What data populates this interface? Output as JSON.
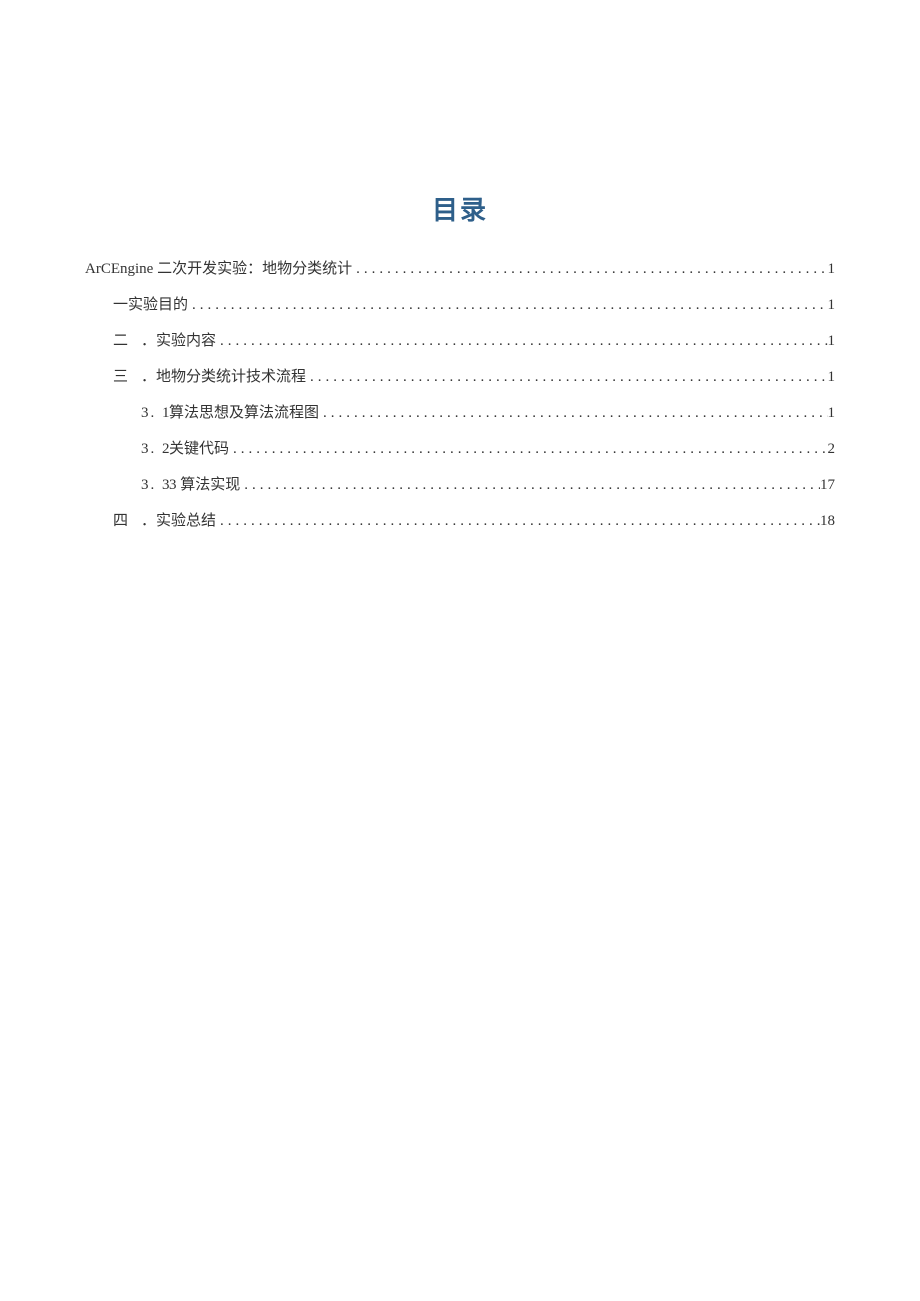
{
  "title": "目录",
  "toc": [
    {
      "prefix": "",
      "label": "ArCEngine 二次开发实验：地物分类统计",
      "page": "1",
      "indent": 0
    },
    {
      "prefix": "",
      "label": "一实验目的",
      "page": "1",
      "indent": 1
    },
    {
      "prefix": "二",
      "label": "．实验内容",
      "page": "1",
      "indent": 1
    },
    {
      "prefix": "三",
      "label": "．地物分类统计技术流程",
      "page": "1",
      "indent": 1
    },
    {
      "prefix": "3. 1",
      "label": " 算法思想及算法流程图",
      "page": "1",
      "indent": 2
    },
    {
      "prefix": "3. 2",
      "label": " 关键代码",
      "page": "2",
      "indent": 2
    },
    {
      "prefix": "3. 3",
      "label": " 3 算法实现",
      "page": "17",
      "indent": 2
    },
    {
      "prefix": "四",
      "label": "．实验总结",
      "page": "18",
      "indent": 1
    }
  ]
}
